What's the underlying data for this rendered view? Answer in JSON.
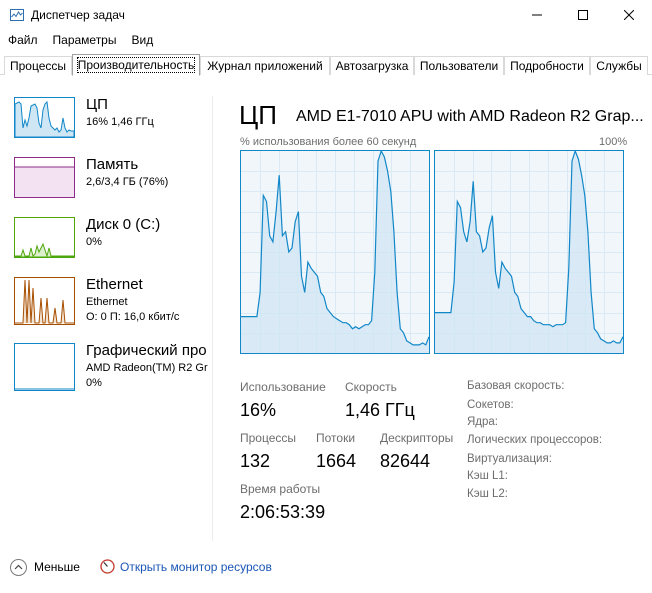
{
  "window": {
    "title": "Диспетчер задач"
  },
  "menu": [
    "Файл",
    "Параметры",
    "Вид"
  ],
  "tabs": [
    {
      "label": "Процессы",
      "active": false
    },
    {
      "label": "Производительность",
      "active": true
    },
    {
      "label": "Журнал приложений",
      "active": false
    },
    {
      "label": "Автозагрузка",
      "active": false
    },
    {
      "label": "Пользователи",
      "active": false
    },
    {
      "label": "Подробности",
      "active": false
    },
    {
      "label": "Службы",
      "active": false
    }
  ],
  "sidebar": {
    "items": [
      {
        "title": "ЦП",
        "sub1": "16% 1,46 ГГц",
        "sub2": "",
        "color": "#1187c8",
        "selected": true
      },
      {
        "title": "Память",
        "sub1": "2,6/3,4 ГБ (76%)",
        "sub2": "",
        "color": "#8e2a8b",
        "selected": false
      },
      {
        "title": "Диск 0 (C:)",
        "sub1": "0%",
        "sub2": "",
        "color": "#4da60c",
        "selected": false
      },
      {
        "title": "Ethernet",
        "sub1": "Ethernet",
        "sub2": "О: 0 П: 16,0 кбит/с",
        "color": "#a74f01",
        "selected": false
      },
      {
        "title": "Графический про",
        "sub1": "AMD Radeon(TM) R2 Gr",
        "sub2": "0%",
        "color": "#1187c8",
        "selected": false
      }
    ]
  },
  "main": {
    "heading": "ЦП",
    "model": "AMD E1-7010 APU with AMD Radeon R2 Grap...",
    "graph_caption": "% использования более 60 секунд",
    "graph_max": "100%",
    "graph_color": "#1187c8",
    "core_graphs": [
      [
        82,
        82,
        82,
        82,
        82,
        82,
        70,
        22,
        25,
        42,
        45,
        30,
        12,
        42,
        40,
        50,
        48,
        35,
        30,
        62,
        70,
        55,
        58,
        60,
        62,
        70,
        72,
        78,
        80,
        82,
        83,
        84,
        85,
        85,
        86,
        88,
        87,
        88,
        87,
        86,
        86,
        84,
        60,
        5,
        0,
        3,
        10,
        20,
        40,
        70,
        88,
        90,
        94,
        95,
        96,
        96,
        96,
        95,
        96,
        92
      ],
      [
        80,
        80,
        80,
        80,
        80,
        80,
        65,
        25,
        28,
        40,
        45,
        35,
        15,
        40,
        42,
        50,
        48,
        38,
        32,
        60,
        68,
        55,
        58,
        60,
        62,
        70,
        72,
        78,
        80,
        82,
        82,
        84,
        85,
        85,
        86,
        86,
        86,
        87,
        86,
        86,
        86,
        85,
        58,
        5,
        0,
        4,
        12,
        22,
        40,
        70,
        88,
        90,
        93,
        94,
        95,
        95,
        94,
        95,
        95,
        92
      ]
    ],
    "stats": {
      "usage_label": "Использование",
      "usage_value": "16%",
      "speed_label": "Скорость",
      "speed_value": "1,46 ГГц",
      "processes_label": "Процессы",
      "processes_value": "132",
      "threads_label": "Потоки",
      "threads_value": "1664",
      "handles_label": "Дескрипторы",
      "handles_value": "82644",
      "uptime_label": "Время работы",
      "uptime_value": "2:06:53:39"
    },
    "info": [
      "Базовая скорость:",
      "Сокетов:",
      "Ядра:",
      "Логических процессоров:",
      "Виртуализация:",
      "Кэш L1:",
      "Кэш L2:"
    ]
  },
  "footer": {
    "fewer_label": "Меньше",
    "monitor_link": "Открыть монитор ресурсов"
  }
}
